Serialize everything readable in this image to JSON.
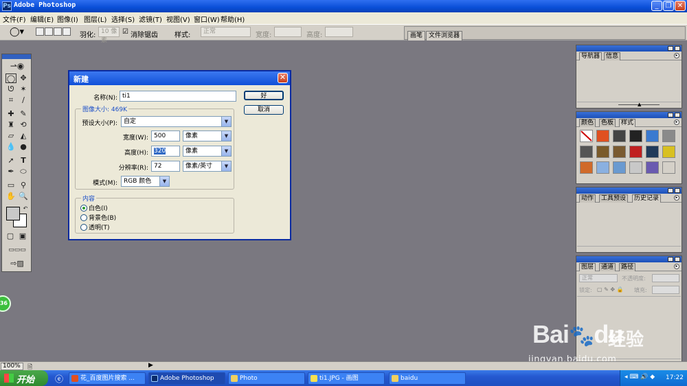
{
  "window": {
    "title": "Adobe Photoshop",
    "logo": "Ps"
  },
  "window_buttons": {
    "minimize": "_",
    "restore": "❐",
    "close": "✕"
  },
  "menu": [
    "文件(F)",
    "编辑(E)",
    "图像(I)",
    "图层(L)",
    "选择(S)",
    "滤镜(T)",
    "视图(V)",
    "窗口(W)",
    "帮助(H)"
  ],
  "options": {
    "feather_label": "羽化:",
    "feather_value": "10 像素",
    "antialias_label": "消除锯齿",
    "style_label": "样式:",
    "style_value": "正常",
    "width_label": "宽度:",
    "height_label": "高度:",
    "well_tabs": [
      "画笔",
      "文件浏览器"
    ]
  },
  "palettes": {
    "navigator": {
      "tabs": [
        "导航器",
        "信息"
      ]
    },
    "swatches": {
      "tabs": [
        "颜色",
        "色板",
        "样式"
      ],
      "style_colors": [
        "#ffffff",
        "#e05020",
        "#444444",
        "#222222",
        "#3a7ad0",
        "#8a8a8a",
        "#555555",
        "#7a5a2a",
        "#7a5a30",
        "#c02020",
        "#203a5a",
        "#d8c020",
        "#d06a2a",
        "#8ab0e0",
        "#6a9ad0",
        "#c8c8c8",
        "#6a5ab0",
        "#d4d0c8"
      ]
    },
    "actions": {
      "tabs": [
        "动作",
        "工具预设",
        "历史记录"
      ]
    },
    "layers": {
      "tabs": [
        "图层",
        "通道",
        "路径"
      ],
      "blend_mode": "正常",
      "opacity_label": "不透明度:",
      "lock_label": "锁定:",
      "fill_label": "填充:"
    }
  },
  "dialog": {
    "title": "新建",
    "name_label": "名称(N):",
    "name_value": "ti1",
    "image_size_label": "图像大小: 469K",
    "preset_label": "预设大小(P):",
    "preset_value": "自定",
    "width_label": "宽度(W):",
    "width_value": "500",
    "width_unit": "像素",
    "height_label": "高度(H):",
    "height_value": "320",
    "height_unit": "像素",
    "resolution_label": "分辨率(R):",
    "resolution_value": "72",
    "resolution_unit": "像素/英寸",
    "mode_label": "模式(M):",
    "mode_value": "RGB 颜色",
    "contents_label": "内容",
    "contents_options": [
      "白色(I)",
      "背景色(B)",
      "透明(T)"
    ],
    "contents_selected": 0,
    "ok_label": "好",
    "cancel_label": "取消"
  },
  "statusbar": {
    "zoom": "100%"
  },
  "taskbar": {
    "start_label": "开始",
    "tasks": [
      {
        "label": "花_百度图片搜索 ..."
      },
      {
        "label": "Adobe Photoshop"
      },
      {
        "label": "Photo"
      },
      {
        "label": "ti1.JPG - 画图"
      },
      {
        "label": "baidu"
      }
    ],
    "clock": "17:22"
  },
  "watermark": {
    "logo_text": "Bai",
    "logo_text2": "du",
    "cn_text": "经验",
    "url": "jingyan.baidu.com"
  },
  "badge_text": "36"
}
